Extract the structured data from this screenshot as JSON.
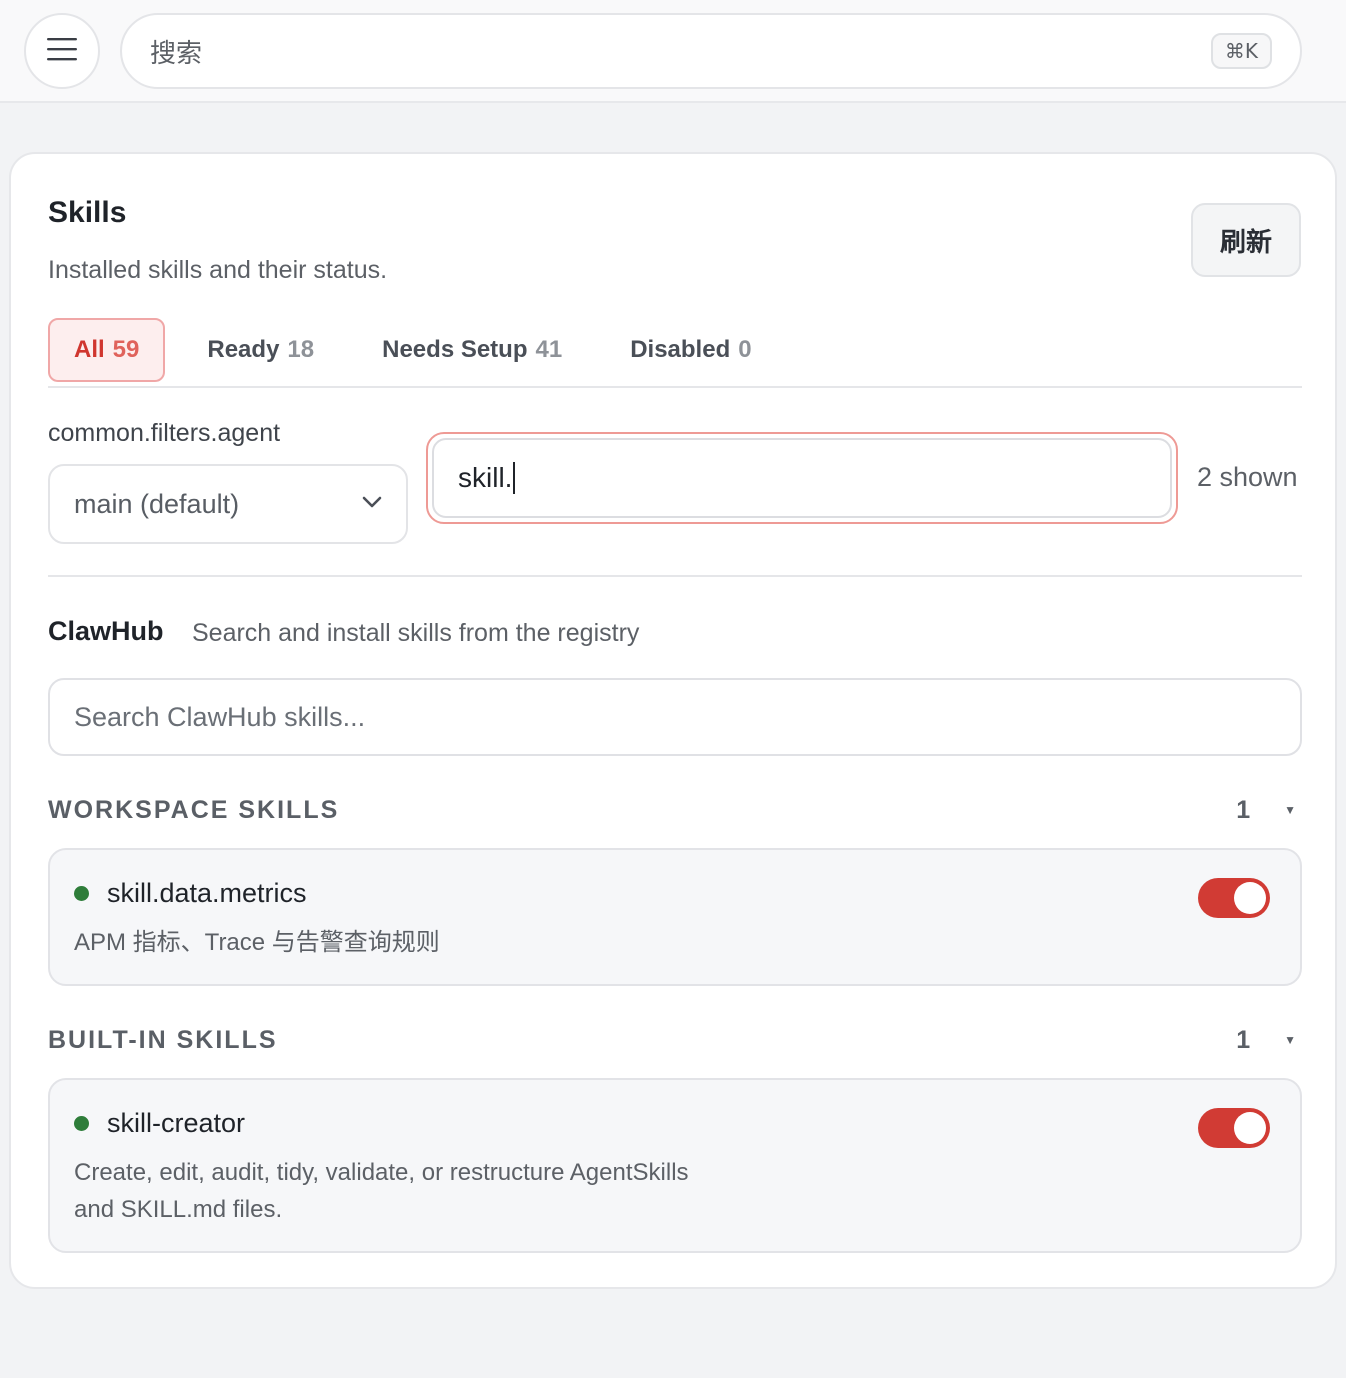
{
  "topbar": {
    "search_placeholder": "搜索",
    "shortcut": "⌘K"
  },
  "header": {
    "title": "Skills",
    "subtitle": "Installed skills and their status.",
    "refresh_label": "刷新"
  },
  "tabs": [
    {
      "label": "All",
      "count": "59",
      "active": true
    },
    {
      "label": "Ready",
      "count": "18",
      "active": false
    },
    {
      "label": "Needs Setup",
      "count": "41",
      "active": false
    },
    {
      "label": "Disabled",
      "count": "0",
      "active": false
    }
  ],
  "filters": {
    "agent_label": "common.filters.agent",
    "agent_value": "main (default)",
    "query": "skill.",
    "shown": "2 shown"
  },
  "clawhub": {
    "title": "ClawHub",
    "description": "Search and install skills from the registry",
    "search_placeholder": "Search ClawHub skills..."
  },
  "sections": [
    {
      "name": "WORKSPACE SKILLS",
      "count": "1",
      "skills": [
        {
          "name": "skill.data.metrics",
          "description": "APM 指标、Trace 与告警查询规则",
          "enabled": true,
          "status_color": "#2e7d3a"
        }
      ]
    },
    {
      "name": "BUILT-IN SKILLS",
      "count": "1",
      "skills": [
        {
          "name": "skill-creator",
          "description_lines": [
            "Create, edit, audit, tidy, validate, or restructure AgentSkills",
            "and SKILL.md files."
          ],
          "enabled": true,
          "status_color": "#2e7d3a"
        }
      ]
    }
  ],
  "colors": {
    "accent": "#d13b34",
    "active_tab_bg": "#fdeeee",
    "status_ok": "#2e7d3a"
  }
}
